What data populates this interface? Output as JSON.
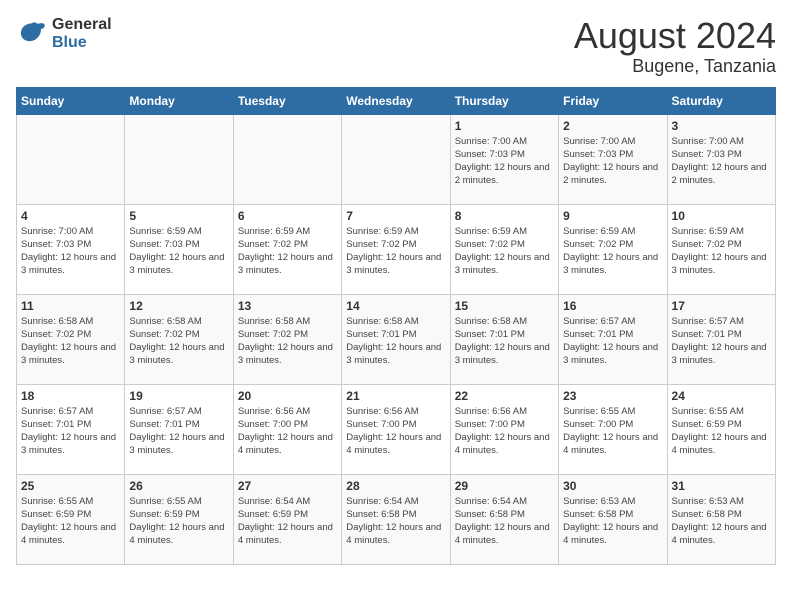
{
  "header": {
    "logo_line1": "General",
    "logo_line2": "Blue",
    "title": "August 2024",
    "subtitle": "Bugene, Tanzania"
  },
  "weekdays": [
    "Sunday",
    "Monday",
    "Tuesday",
    "Wednesday",
    "Thursday",
    "Friday",
    "Saturday"
  ],
  "weeks": [
    [
      {
        "day": "",
        "sunrise": "",
        "sunset": "",
        "daylight": ""
      },
      {
        "day": "",
        "sunrise": "",
        "sunset": "",
        "daylight": ""
      },
      {
        "day": "",
        "sunrise": "",
        "sunset": "",
        "daylight": ""
      },
      {
        "day": "",
        "sunrise": "",
        "sunset": "",
        "daylight": ""
      },
      {
        "day": "1",
        "sunrise": "Sunrise: 7:00 AM",
        "sunset": "Sunset: 7:03 PM",
        "daylight": "Daylight: 12 hours and 2 minutes."
      },
      {
        "day": "2",
        "sunrise": "Sunrise: 7:00 AM",
        "sunset": "Sunset: 7:03 PM",
        "daylight": "Daylight: 12 hours and 2 minutes."
      },
      {
        "day": "3",
        "sunrise": "Sunrise: 7:00 AM",
        "sunset": "Sunset: 7:03 PM",
        "daylight": "Daylight: 12 hours and 2 minutes."
      }
    ],
    [
      {
        "day": "4",
        "sunrise": "Sunrise: 7:00 AM",
        "sunset": "Sunset: 7:03 PM",
        "daylight": "Daylight: 12 hours and 3 minutes."
      },
      {
        "day": "5",
        "sunrise": "Sunrise: 6:59 AM",
        "sunset": "Sunset: 7:03 PM",
        "daylight": "Daylight: 12 hours and 3 minutes."
      },
      {
        "day": "6",
        "sunrise": "Sunrise: 6:59 AM",
        "sunset": "Sunset: 7:02 PM",
        "daylight": "Daylight: 12 hours and 3 minutes."
      },
      {
        "day": "7",
        "sunrise": "Sunrise: 6:59 AM",
        "sunset": "Sunset: 7:02 PM",
        "daylight": "Daylight: 12 hours and 3 minutes."
      },
      {
        "day": "8",
        "sunrise": "Sunrise: 6:59 AM",
        "sunset": "Sunset: 7:02 PM",
        "daylight": "Daylight: 12 hours and 3 minutes."
      },
      {
        "day": "9",
        "sunrise": "Sunrise: 6:59 AM",
        "sunset": "Sunset: 7:02 PM",
        "daylight": "Daylight: 12 hours and 3 minutes."
      },
      {
        "day": "10",
        "sunrise": "Sunrise: 6:59 AM",
        "sunset": "Sunset: 7:02 PM",
        "daylight": "Daylight: 12 hours and 3 minutes."
      }
    ],
    [
      {
        "day": "11",
        "sunrise": "Sunrise: 6:58 AM",
        "sunset": "Sunset: 7:02 PM",
        "daylight": "Daylight: 12 hours and 3 minutes."
      },
      {
        "day": "12",
        "sunrise": "Sunrise: 6:58 AM",
        "sunset": "Sunset: 7:02 PM",
        "daylight": "Daylight: 12 hours and 3 minutes."
      },
      {
        "day": "13",
        "sunrise": "Sunrise: 6:58 AM",
        "sunset": "Sunset: 7:02 PM",
        "daylight": "Daylight: 12 hours and 3 minutes."
      },
      {
        "day": "14",
        "sunrise": "Sunrise: 6:58 AM",
        "sunset": "Sunset: 7:01 PM",
        "daylight": "Daylight: 12 hours and 3 minutes."
      },
      {
        "day": "15",
        "sunrise": "Sunrise: 6:58 AM",
        "sunset": "Sunset: 7:01 PM",
        "daylight": "Daylight: 12 hours and 3 minutes."
      },
      {
        "day": "16",
        "sunrise": "Sunrise: 6:57 AM",
        "sunset": "Sunset: 7:01 PM",
        "daylight": "Daylight: 12 hours and 3 minutes."
      },
      {
        "day": "17",
        "sunrise": "Sunrise: 6:57 AM",
        "sunset": "Sunset: 7:01 PM",
        "daylight": "Daylight: 12 hours and 3 minutes."
      }
    ],
    [
      {
        "day": "18",
        "sunrise": "Sunrise: 6:57 AM",
        "sunset": "Sunset: 7:01 PM",
        "daylight": "Daylight: 12 hours and 3 minutes."
      },
      {
        "day": "19",
        "sunrise": "Sunrise: 6:57 AM",
        "sunset": "Sunset: 7:01 PM",
        "daylight": "Daylight: 12 hours and 3 minutes."
      },
      {
        "day": "20",
        "sunrise": "Sunrise: 6:56 AM",
        "sunset": "Sunset: 7:00 PM",
        "daylight": "Daylight: 12 hours and 4 minutes."
      },
      {
        "day": "21",
        "sunrise": "Sunrise: 6:56 AM",
        "sunset": "Sunset: 7:00 PM",
        "daylight": "Daylight: 12 hours and 4 minutes."
      },
      {
        "day": "22",
        "sunrise": "Sunrise: 6:56 AM",
        "sunset": "Sunset: 7:00 PM",
        "daylight": "Daylight: 12 hours and 4 minutes."
      },
      {
        "day": "23",
        "sunrise": "Sunrise: 6:55 AM",
        "sunset": "Sunset: 7:00 PM",
        "daylight": "Daylight: 12 hours and 4 minutes."
      },
      {
        "day": "24",
        "sunrise": "Sunrise: 6:55 AM",
        "sunset": "Sunset: 6:59 PM",
        "daylight": "Daylight: 12 hours and 4 minutes."
      }
    ],
    [
      {
        "day": "25",
        "sunrise": "Sunrise: 6:55 AM",
        "sunset": "Sunset: 6:59 PM",
        "daylight": "Daylight: 12 hours and 4 minutes."
      },
      {
        "day": "26",
        "sunrise": "Sunrise: 6:55 AM",
        "sunset": "Sunset: 6:59 PM",
        "daylight": "Daylight: 12 hours and 4 minutes."
      },
      {
        "day": "27",
        "sunrise": "Sunrise: 6:54 AM",
        "sunset": "Sunset: 6:59 PM",
        "daylight": "Daylight: 12 hours and 4 minutes."
      },
      {
        "day": "28",
        "sunrise": "Sunrise: 6:54 AM",
        "sunset": "Sunset: 6:58 PM",
        "daylight": "Daylight: 12 hours and 4 minutes."
      },
      {
        "day": "29",
        "sunrise": "Sunrise: 6:54 AM",
        "sunset": "Sunset: 6:58 PM",
        "daylight": "Daylight: 12 hours and 4 minutes."
      },
      {
        "day": "30",
        "sunrise": "Sunrise: 6:53 AM",
        "sunset": "Sunset: 6:58 PM",
        "daylight": "Daylight: 12 hours and 4 minutes."
      },
      {
        "day": "31",
        "sunrise": "Sunrise: 6:53 AM",
        "sunset": "Sunset: 6:58 PM",
        "daylight": "Daylight: 12 hours and 4 minutes."
      }
    ]
  ]
}
